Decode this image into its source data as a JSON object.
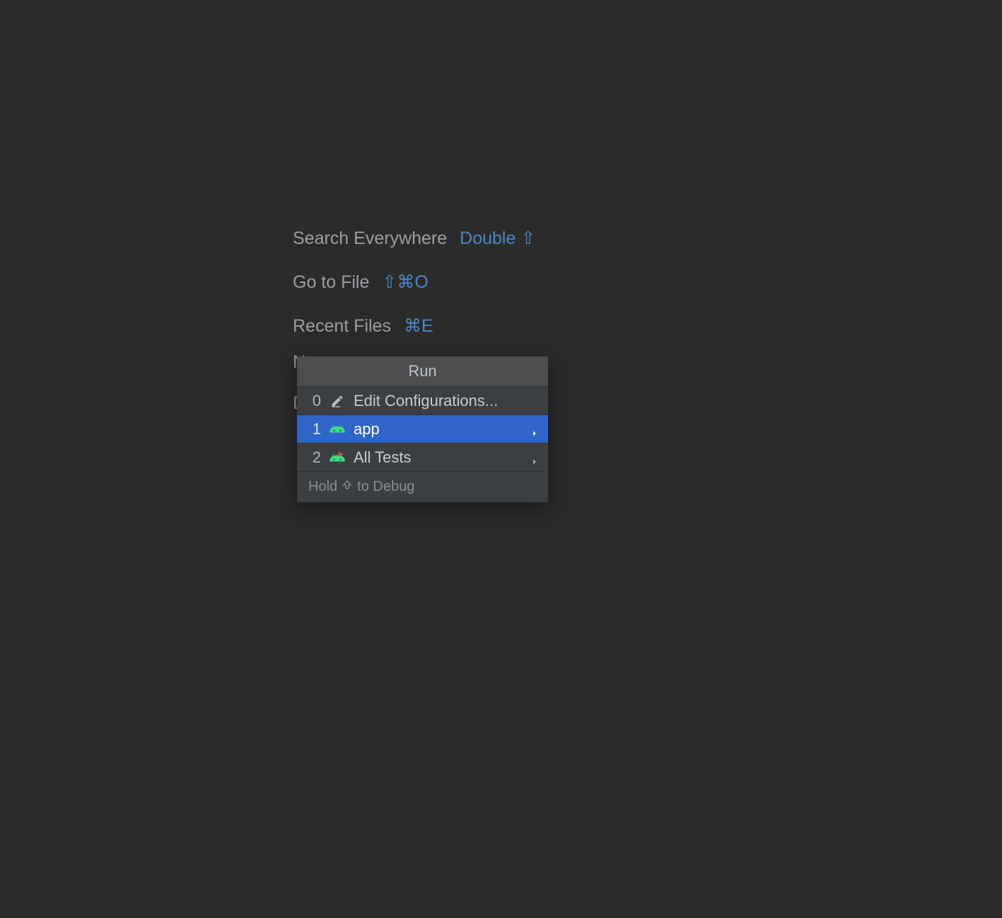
{
  "colors": {
    "background": "#2b2b2b",
    "popup_bg": "#3c3f41",
    "popup_header_bg": "#4b4d4f",
    "selection_bg": "#2f65ca",
    "text_dim": "#9a9ea3",
    "text_light": "#c7cbd0",
    "accent_link": "#4a88c7",
    "android_green": "#3ddc84"
  },
  "shortcuts": {
    "search_everywhere": {
      "label": "Search Everywhere",
      "key": "Double ⇧"
    },
    "go_to_file": {
      "label": "Go to File",
      "key": "⇧⌘O"
    },
    "recent_files": {
      "label": "Recent Files",
      "key": "⌘E"
    }
  },
  "popup": {
    "title": "Run",
    "items": [
      {
        "num": "0",
        "icon": "pencil-icon",
        "label": "Edit Configurations...",
        "sub": false,
        "selected": false
      },
      {
        "num": "1",
        "icon": "android-icon",
        "label": "app",
        "sub": true,
        "selected": true
      },
      {
        "num": "2",
        "icon": "android-test-icon",
        "label": "All Tests",
        "sub": true,
        "selected": false
      }
    ],
    "footer_pre": "Hold ",
    "footer_post": " to Debug"
  }
}
